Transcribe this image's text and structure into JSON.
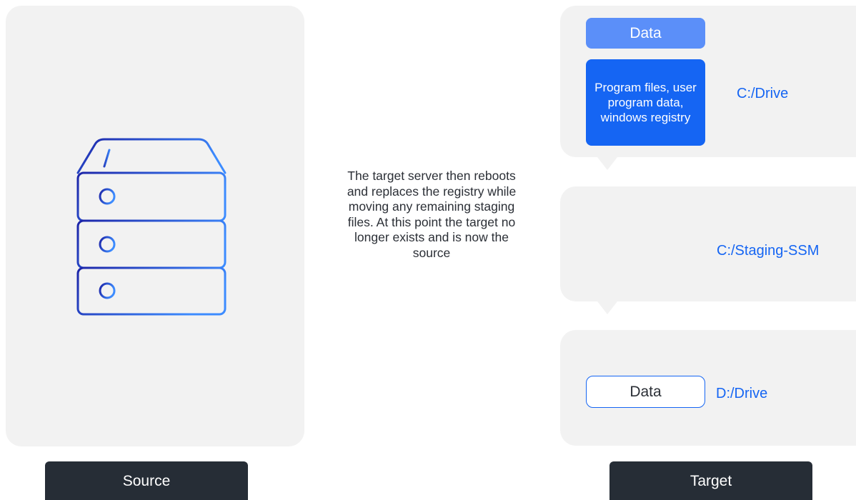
{
  "colors": {
    "panel_bg": "#f2f2f2",
    "accent_blue": "#1565f3",
    "light_blue": "#5b8ff9",
    "caption_bg": "#262d36",
    "icon_gradient_start": "#1c24a8",
    "icon_gradient_end": "#3d8cff"
  },
  "source": {
    "icon": "server-rack-icon",
    "caption": "Source"
  },
  "description": "The target server then reboots and replaces the registry while moving any remaining staging files. At this point the target no longer exists and is now the source",
  "target": {
    "c_drive": {
      "header": "Data",
      "content": "Program files, user program data, windows registry",
      "label": "C:/Drive"
    },
    "staging": {
      "label": "C:/Staging-SSM"
    },
    "d_drive": {
      "box": "Data",
      "label": "D:/Drive"
    },
    "caption": "Target"
  }
}
